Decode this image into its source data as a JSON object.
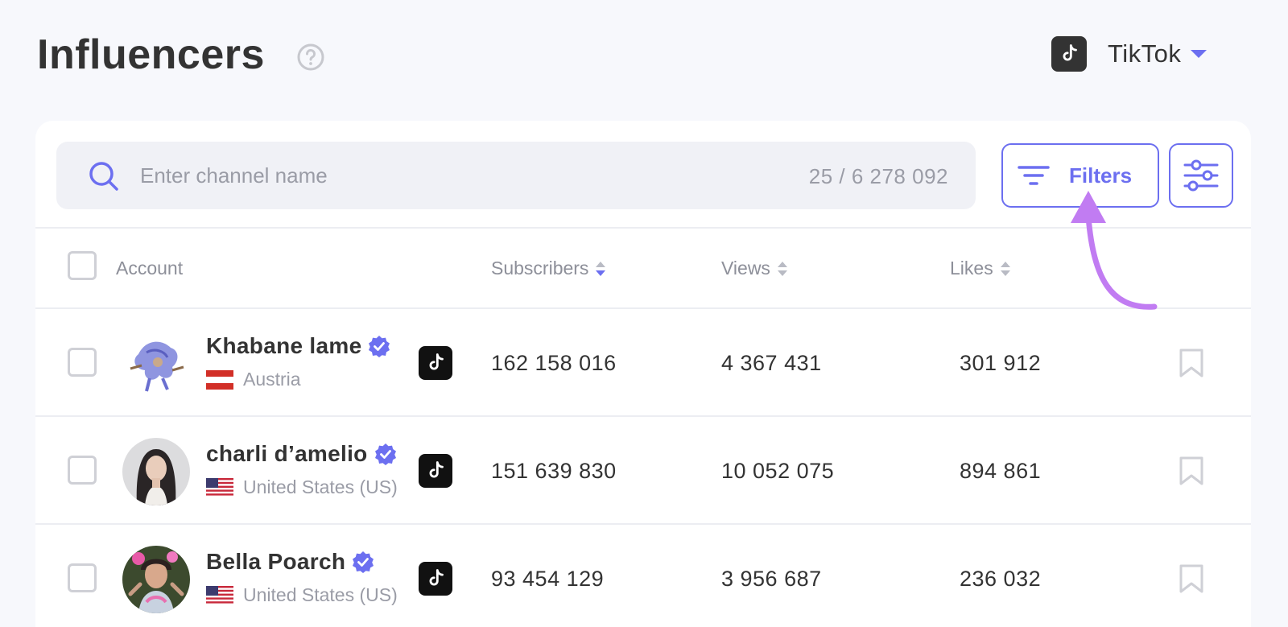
{
  "header": {
    "title": "Influencers",
    "platform": "TikTok"
  },
  "search": {
    "placeholder": "Enter channel name",
    "value": "",
    "count": "25 / 6 278 092"
  },
  "toolbar": {
    "filters_label": "Filters"
  },
  "table": {
    "columns": {
      "account": "Account",
      "subscribers": "Subscribers",
      "views": "Views",
      "likes": "Likes"
    },
    "rows": [
      {
        "name": "Khabane lame",
        "country": "Austria",
        "subscribers": "162 158 016",
        "views": "4 367 431",
        "likes": "301 912"
      },
      {
        "name": "charli d’amelio",
        "country": "United States (US)",
        "subscribers": "151 639 830",
        "views": "10 052 075",
        "likes": "894 861"
      },
      {
        "name": "Bella Poarch",
        "country": "United States (US)",
        "subscribers": "93 454 129",
        "views": "3 956 687",
        "likes": "236 032"
      }
    ]
  },
  "colors": {
    "accent": "#6c6ff0",
    "arrow": "#c17cf2",
    "text": "#333333",
    "muted": "#9a9ca6"
  },
  "icons": [
    "help-icon",
    "tiktok-icon",
    "chevron-down-icon",
    "search-icon",
    "filter-icon",
    "settings-sliders-icon",
    "sort-icon",
    "verified-icon",
    "bookmark-icon",
    "arrow-icon"
  ]
}
